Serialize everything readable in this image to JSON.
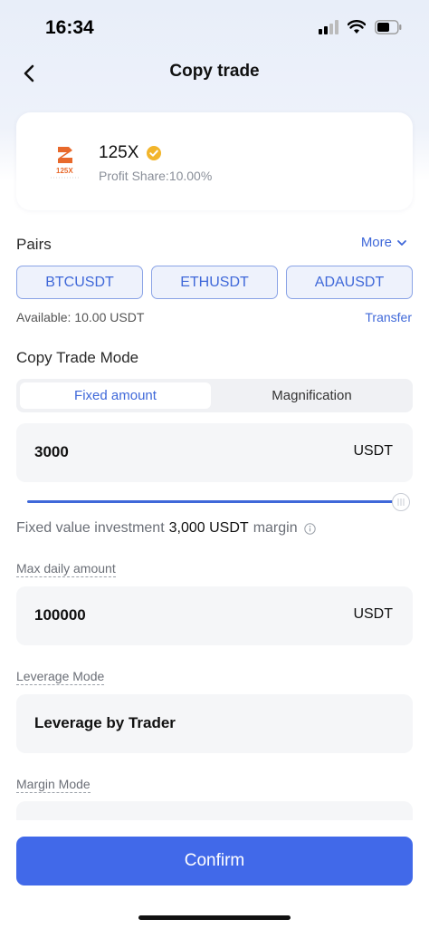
{
  "status_bar": {
    "time": "16:34"
  },
  "nav": {
    "title": "Copy trade"
  },
  "trader": {
    "name": "125X",
    "logo_text": "125X",
    "profit_share": "Profit Share:10.00%"
  },
  "pairs": {
    "label": "Pairs",
    "more_label": "More",
    "items": [
      "BTCUSDT",
      "ETHUSDT",
      "ADAUSDT"
    ],
    "available": "Available:  10.00 USDT",
    "transfer_label": "Transfer"
  },
  "copy_mode": {
    "label": "Copy Trade Mode",
    "options": [
      "Fixed amount",
      "Magnification"
    ],
    "selected": "Fixed amount"
  },
  "fixed_amount": {
    "value": "3000",
    "unit": "USDT",
    "slider_fraction": 1.0,
    "info_prefix": "Fixed value investment",
    "info_amount": "3,000 USDT",
    "info_suffix": "margin"
  },
  "max_daily": {
    "label": "Max daily amount",
    "value": "100000",
    "unit": "USDT"
  },
  "leverage": {
    "label": "Leverage Mode",
    "value": "Leverage by Trader"
  },
  "margin": {
    "label": "Margin Mode"
  },
  "confirm_label": "Confirm",
  "colors": {
    "accent": "#4169e9",
    "link": "#3f68d9",
    "verified": "#f2b52b",
    "logo_orange": "#e8692b"
  }
}
